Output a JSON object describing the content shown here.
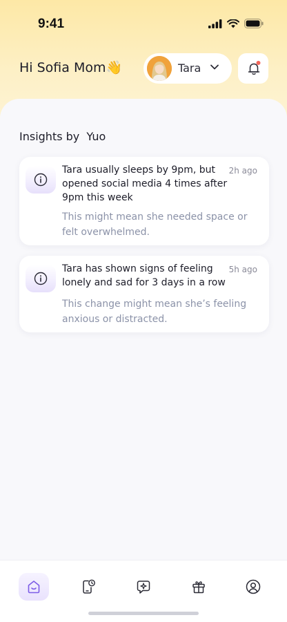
{
  "status_bar": {
    "time": "9:41"
  },
  "header": {
    "greeting": "Hi Sofia Mom",
    "greeting_emoji": "👋",
    "child_selector": {
      "name": "Tara"
    },
    "notification": {
      "has_unread": true
    }
  },
  "insights": {
    "title": "Insights by  Yuo",
    "cards": [
      {
        "title": "Tara usually sleeps by 9pm, but opened social media 4 times after 9pm this week",
        "time": "2h ago",
        "description": "This might mean she needed space or felt overwhelmed."
      },
      {
        "title": "Tara has shown signs of feeling lonely and sad for 3 days in a row",
        "time": "5h ago",
        "description": "This change might mean she’s feeling anxious or distracted."
      }
    ]
  },
  "bottom_nav": {
    "items": [
      "home-icon",
      "phone-clock-icon",
      "chat-sparkle-icon",
      "gift-icon",
      "profile-icon"
    ],
    "active": "home-icon"
  },
  "colors": {
    "header_bg": "#fde8a6",
    "accent": "#7c5ce6",
    "notification_dot": "#f2665a",
    "muted_text": "#8b92a8"
  }
}
